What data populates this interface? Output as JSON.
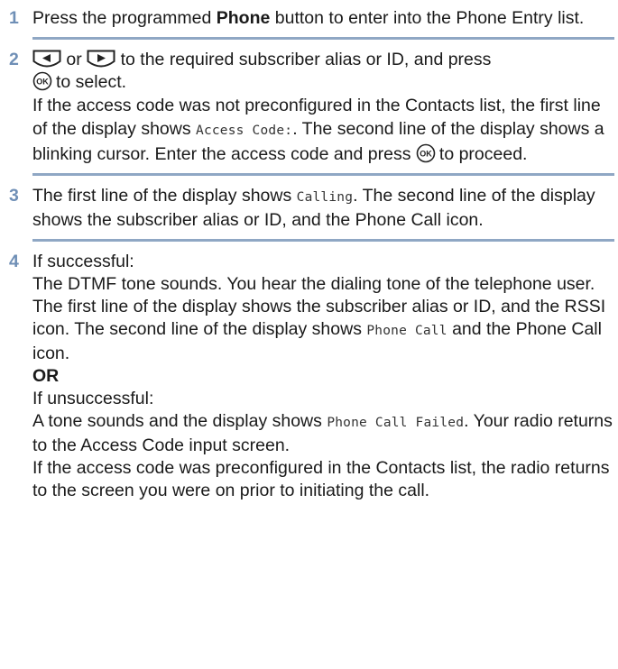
{
  "steps": [
    {
      "number": "1",
      "pre": "Press the programmed ",
      "bold": "Phone",
      "post": " button to enter into the Phone Entry list."
    },
    {
      "number": "2",
      "line1_or": "or",
      "line1_rest": "to the required subscriber alias or ID, and press",
      "line2": "to select.",
      "p2_pre": "If the access code was not preconfigured in the Contacts list, the first line of the display shows ",
      "p2_code": "Access Code:",
      "p2_post": ". The second line of the display shows a blinking cursor. Enter the access code and press ",
      "p2_end": "to proceed."
    },
    {
      "number": "3",
      "pre": "The first line of the display shows ",
      "code": "Calling",
      "post": ". The second line of the display shows the subscriber alias or ID, and the Phone Call icon."
    },
    {
      "number": "4",
      "l1": "If successful:",
      "p_pre": "The DTMF tone sounds. You hear the dialing tone of the telephone user. The first line of the display shows the subscriber alias or ID, and the RSSI icon. The second line of the display shows ",
      "p_code": "Phone Call",
      "p_post": " and the Phone Call icon.",
      "or": "OR",
      "l2": "If unsuccessful:",
      "q_pre": "A tone sounds and the display shows ",
      "q_code": "Phone Call Failed",
      "q_post": ". Your radio returns to the Access Code input screen.",
      "r": "If the access code was preconfigured in the Contacts list, the radio returns to the screen you were on prior to initiating the call."
    }
  ],
  "icons": {
    "left_arrow": "left-arrow-key-icon",
    "right_arrow": "right-arrow-key-icon",
    "ok": "ok-key-icon"
  },
  "colors": {
    "step_number": "#6f8fb6",
    "rule": "#8fa7c4"
  }
}
